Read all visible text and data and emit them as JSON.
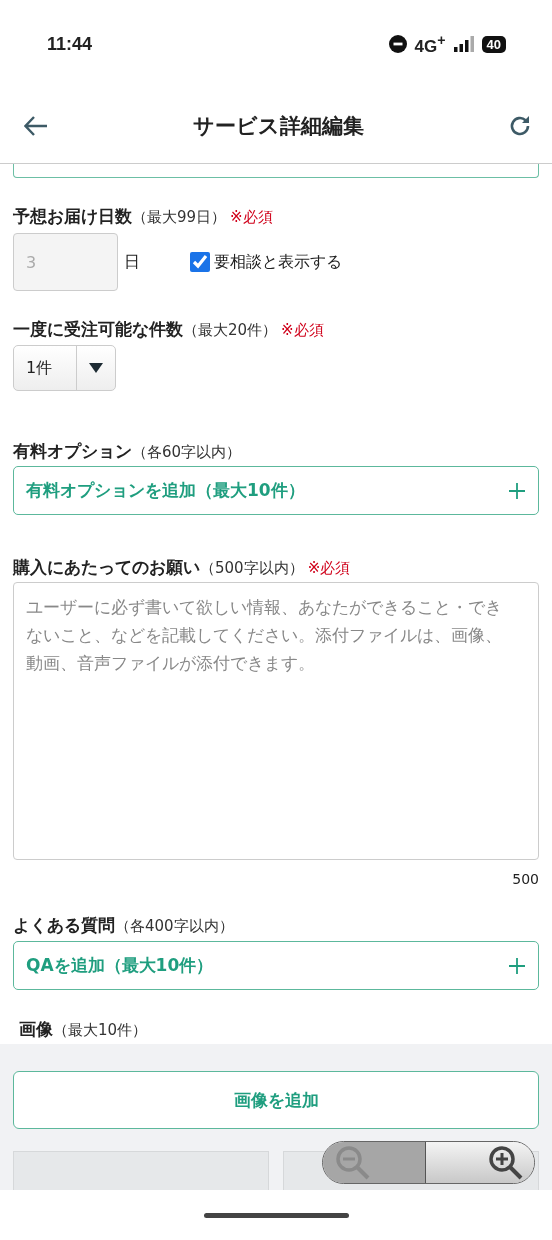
{
  "status_bar": {
    "time": "11:44",
    "network": "4G$^{+}$",
    "battery": "40"
  },
  "header": {
    "title": "サービス詳細編集"
  },
  "delivery": {
    "label": "予想お届け日数",
    "note": "（最大99日）",
    "required": "※必須",
    "value": "3",
    "disabled": true,
    "unit": "日",
    "consult": {
      "label": "要相談と表示する",
      "checked": true
    }
  },
  "capacity": {
    "label": "一度に受注可能な件数",
    "note": "（最大20件）",
    "required": "※必須",
    "value": "1件"
  },
  "paid_options": {
    "label": "有料オプション",
    "note": "（各60字以内）",
    "button": "有料オプションを追加（最大10件）"
  },
  "request": {
    "label": "購入にあたってのお願い",
    "note": "（500字以内）",
    "required": "※必須",
    "placeholder": "ユーザーに必ず書いて欲しい情報、あなたができること・できないこと、などを記載してください。添付ファイルは、画像、動画、音声ファイルが添付できます。",
    "counter": "500"
  },
  "faq": {
    "label": "よくある質問",
    "note": "（各400字以内）",
    "button": "QAを追加（最大10件）"
  },
  "images": {
    "label": "画像",
    "note": "（最大10件）",
    "button": "画像を追加"
  }
}
